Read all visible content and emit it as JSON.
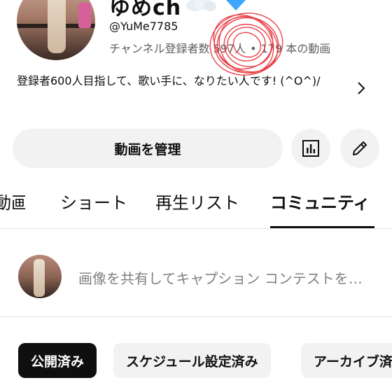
{
  "channel": {
    "name": "ゆめch",
    "handle": "@YuMe7785",
    "subscribers_label": "チャンネル登録者数 597人",
    "separator": "•",
    "videos_label": "179 本の動画",
    "description": "登録者600人目指して、歌い手に、なりたい人です! (^O^)/"
  },
  "actions": {
    "manage_label": "動画を管理",
    "analytics_icon": "analytics-icon",
    "edit_icon": "pencil-icon"
  },
  "tabs": [
    {
      "label": "動画",
      "selected": false
    },
    {
      "label": "ショート",
      "selected": false
    },
    {
      "label": "再生リスト",
      "selected": false
    },
    {
      "label": "コミュニティ",
      "selected": true
    }
  ],
  "composer": {
    "placeholder": "画像を共有してキャプション コンテストを…"
  },
  "chips": [
    {
      "label": "公開済み",
      "selected": true
    },
    {
      "label": "スケジュール設定済み",
      "selected": false
    },
    {
      "label": "アーカイブ済み",
      "selected": false
    }
  ],
  "colors": {
    "scribble": "#e8434a",
    "heart": "#3ea6ff",
    "chip_selected": "#0f0f0f",
    "chip_default": "#f2f2f2"
  }
}
